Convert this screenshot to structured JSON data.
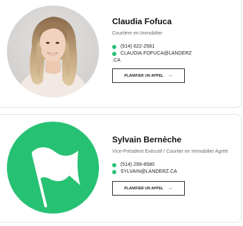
{
  "brand": {
    "accent": "#27c174"
  },
  "agents": [
    {
      "name": "Claudia Fofuca",
      "role": "Courtière en Immobilier",
      "phone": "(514) 622-2581",
      "email_line1": "CLAUDIA.FOFUCA@LANDERZ",
      "email_line2": ".CA",
      "cta_label": "PLANIFIER UN APPEL",
      "cta_icon": "→",
      "photo": "portrait-photo"
    },
    {
      "name": "Sylvain Bernèche",
      "role": "Vice-Président Exécutif / Courtier en Immobilier Agréé",
      "phone": "(514) 299-8580",
      "email": "SYLVAIN@LANDERZ.CA",
      "cta_label": "PLANIFIER UN APPEL",
      "cta_icon": "→",
      "photo": "flag-icon"
    }
  ]
}
